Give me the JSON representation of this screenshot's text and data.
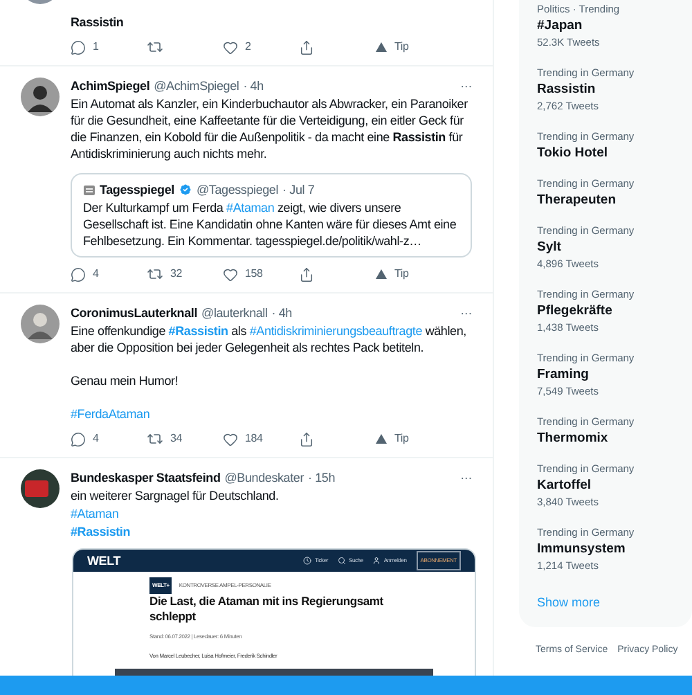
{
  "tweets": [
    {
      "paragraphs": [
        [
          {
            "kind": "text",
            "text": "Rassistin",
            "bold": true
          }
        ]
      ],
      "actions": [
        {
          "kind": "reply",
          "count": "1"
        },
        {
          "kind": "retweet"
        },
        {
          "kind": "like",
          "count": "2"
        },
        {
          "kind": "share"
        },
        {
          "kind": "tip",
          "label": "Tip"
        }
      ]
    },
    {
      "name": "AchimSpiegel",
      "handle": "@AchimSpiegel",
      "time": "· 4h",
      "more": "···",
      "paragraphs": [
        [
          {
            "kind": "text",
            "text": "Ein Automat als Kanzler, ein Kinderbuchautor als Abwracker, ein Paranoiker für die Gesundheit, eine Kaffeetante für die Verteidigung, ein eitler Geck für die Finanzen, ein Kobold für die Außenpolitik - da macht eine "
          },
          {
            "kind": "text",
            "text": "Rassistin",
            "bold": true
          },
          {
            "kind": "text",
            "text": " für Antidiskriminierung auch nichts mehr."
          }
        ]
      ],
      "quote": {
        "name": "Tagesspiegel",
        "verified": true,
        "handle": "@Tagesspiegel",
        "time": "· Jul 7",
        "parts": [
          {
            "kind": "text",
            "text": "Der Kulturkampf um Ferda "
          },
          {
            "kind": "hashtag",
            "text": "#Ataman"
          },
          {
            "kind": "text",
            "text": " zeigt, wie divers unsere Gesellschaft ist. Eine Kandidatin ohne Kanten wäre für dieses Amt eine Fehlbesetzung. Ein Kommentar. tagesspiegel.de/politik/wahl-z…"
          }
        ]
      },
      "actions": [
        {
          "kind": "reply",
          "count": "4"
        },
        {
          "kind": "retweet",
          "count": "32"
        },
        {
          "kind": "like",
          "count": "158"
        },
        {
          "kind": "share"
        },
        {
          "kind": "tip",
          "label": "Tip"
        }
      ]
    },
    {
      "name": "CoronimusLauterknall",
      "handle": "@lauterknall",
      "time": "· 4h",
      "more": "···",
      "paragraphs": [
        [
          {
            "kind": "text",
            "text": "Eine offenkundige "
          },
          {
            "kind": "hashtag",
            "text": "#Rassistin",
            "bold": true
          },
          {
            "kind": "text",
            "text": " als "
          },
          {
            "kind": "hashtag",
            "text": "#Antidiskriminierungsbeauftragte"
          },
          {
            "kind": "text",
            "text": " wählen, aber die Opposition bei jeder Gelegenheit als rechtes Pack betiteln."
          }
        ],
        [
          {
            "kind": "text",
            "text": "Genau mein Humor!"
          }
        ],
        [
          {
            "kind": "hashtag",
            "text": "#FerdaAtaman"
          }
        ]
      ],
      "actions": [
        {
          "kind": "reply",
          "count": "4"
        },
        {
          "kind": "retweet",
          "count": "34"
        },
        {
          "kind": "like",
          "count": "184"
        },
        {
          "kind": "share"
        },
        {
          "kind": "tip",
          "label": "Tip"
        }
      ]
    },
    {
      "name": "Bundeskasper Staatsfeind",
      "handle": "@Bundeskater",
      "time": "· 15h",
      "more": "···",
      "paragraphs": [
        [
          {
            "kind": "text",
            "text": "ein weiterer Sargnagel für Deutschland."
          }
        ],
        [
          {
            "kind": "hashtag",
            "text": "#Ataman"
          }
        ],
        [
          {
            "kind": "hashtag",
            "text": "#Rassistin",
            "bold": true
          }
        ]
      ],
      "article": {
        "logo": "WELT",
        "nav": [
          "Ticker",
          "Suche",
          "Anmelden"
        ],
        "subscribe": "ABONNEMENT",
        "badge": "WELT+",
        "kicker": "KONTROVERSE AMPEL-PERSONALIE",
        "headline": "Die Last, die Ataman mit ins Regierungsamt schleppt",
        "meta": "Stand: 06.07.2022 | Lesedauer: 6 Minuten",
        "authors": "Von Marcel Leubecher, Luisa Hofmeier, Frederik Schindler"
      }
    }
  ],
  "trends": [
    {
      "category": "Politics · Trending",
      "name": "#Japan",
      "count": "52.3K Tweets"
    },
    {
      "category": "Trending in Germany",
      "name": "Rassistin",
      "count": "2,762 Tweets"
    },
    {
      "category": "Trending in Germany",
      "name": "Tokio Hotel"
    },
    {
      "category": "Trending in Germany",
      "name": "Therapeuten"
    },
    {
      "category": "Trending in Germany",
      "name": "Sylt",
      "count": "4,896 Tweets"
    },
    {
      "category": "Trending in Germany",
      "name": "Pflegekräfte",
      "count": "1,438 Tweets"
    },
    {
      "category": "Trending in Germany",
      "name": "Framing",
      "count": "7,549 Tweets"
    },
    {
      "category": "Trending in Germany",
      "name": "Thermomix"
    },
    {
      "category": "Trending in Germany",
      "name": "Kartoffel",
      "count": "3,840 Tweets"
    },
    {
      "category": "Trending in Germany",
      "name": "Immunsystem",
      "count": "1,214 Tweets"
    }
  ],
  "show_more": "Show more",
  "footer_links": [
    "Terms of Service",
    "Privacy Policy"
  ]
}
